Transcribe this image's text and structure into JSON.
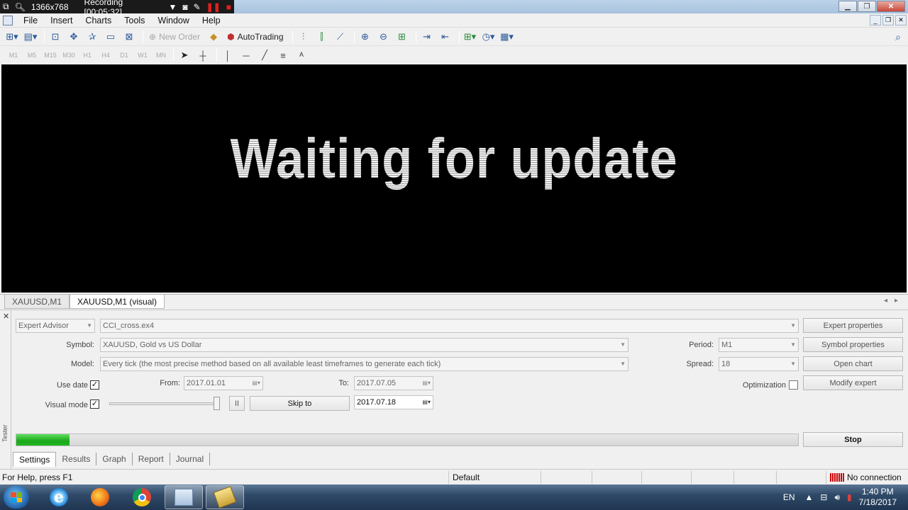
{
  "recording": {
    "resolution": "1366x768",
    "status": "Recording [00:05:32]"
  },
  "menu": [
    "File",
    "Insert",
    "Charts",
    "Tools",
    "Window",
    "Help"
  ],
  "toolbar": {
    "new_order": "New Order",
    "auto_trading": "AutoTrading"
  },
  "timeframes": [
    "M1",
    "M5",
    "M15",
    "M30",
    "H1",
    "H4",
    "D1",
    "W1",
    "MN"
  ],
  "chart": {
    "message": "Waiting for update"
  },
  "chart_tabs": [
    "XAUUSD,M1",
    "XAUUSD,M1 (visual)"
  ],
  "tester": {
    "type": "Expert Advisor",
    "expert": "CCI_cross.ex4",
    "symbol_label": "Symbol:",
    "symbol": "XAUUSD, Gold vs US Dollar",
    "model_label": "Model:",
    "model": "Every tick (the most precise method based on all available least timeframes to generate each tick)",
    "use_date_label": "Use date",
    "use_date_checked": "✓",
    "from_label": "From:",
    "from": "2017.01.01",
    "to_label": "To:",
    "to": "2017.07.05",
    "visual_mode_label": "Visual mode",
    "visual_mode_checked": "✓",
    "pause": "II",
    "skip_to": "Skip to",
    "skip_date": "2017.07.18",
    "period_label": "Period:",
    "period": "M1",
    "spread_label": "Spread:",
    "spread": "18",
    "optimization_label": "Optimization",
    "buttons": {
      "expert_properties": "Expert properties",
      "symbol_properties": "Symbol properties",
      "open_chart": "Open chart",
      "modify_expert": "Modify expert",
      "stop": "Stop"
    },
    "progress_percent": 6.8,
    "side_label": "Tester",
    "tabs": [
      "Settings",
      "Results",
      "Graph",
      "Report",
      "Journal"
    ]
  },
  "status": {
    "help": "For Help, press F1",
    "profile": "Default",
    "connection": "No connection"
  },
  "taskbar": {
    "lang": "EN",
    "time": "1:40 PM",
    "date": "7/18/2017"
  }
}
